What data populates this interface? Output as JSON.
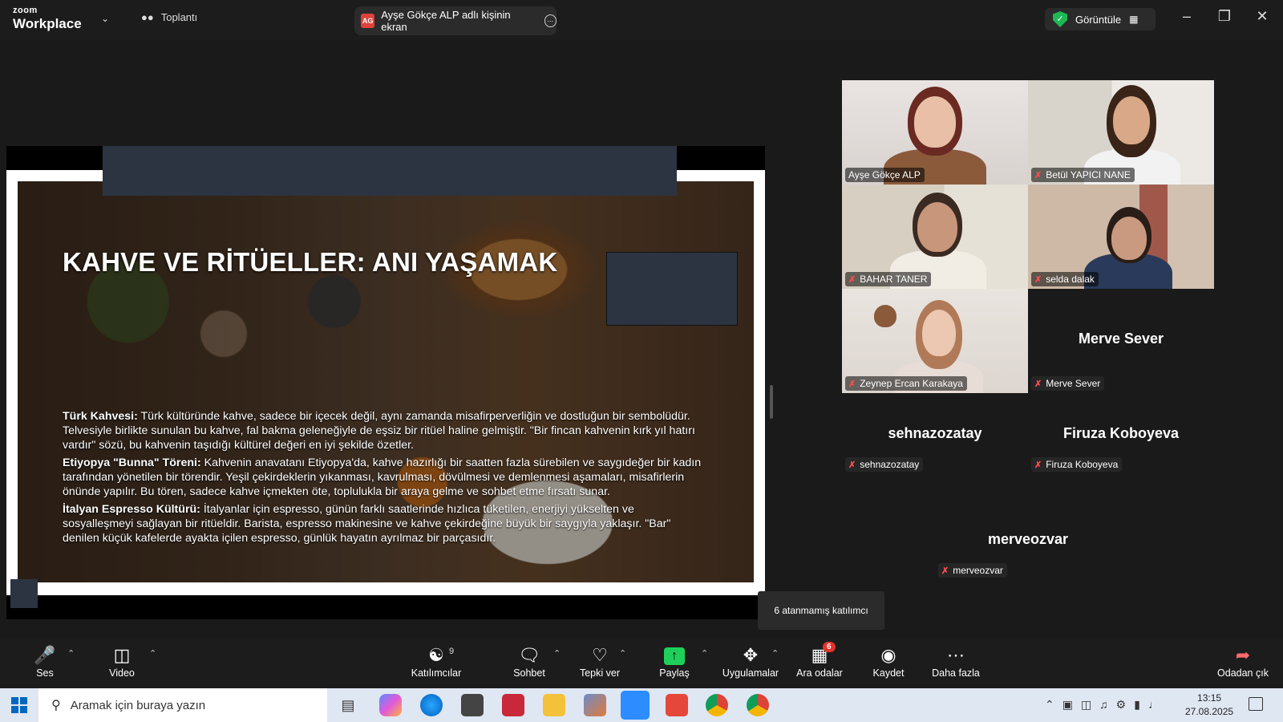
{
  "titlebar": {
    "brand_small": "zoom",
    "brand_large": "Workplace",
    "meeting_label": "Toplantı",
    "share_tab_initials": "AG",
    "share_tab_label": "Ayşe Gökçe ALP adlı kişinin ekran",
    "view_label": "Görüntüle"
  },
  "slide": {
    "title": "KAHVE VE RİTÜELLER: ANI YAŞAMAK",
    "paragraphs": [
      {
        "heading": "Türk Kahvesi:",
        "text": " Türk kültüründe kahve, sadece bir içecek değil, aynı zamanda misafirperverliğin ve dostluğun bir sembolüdür. Telvesiyle birlikte sunulan bu kahve, fal bakma geleneğiyle de eşsiz bir ritüel haline gelmiştir. \"Bir fincan kahvenin kırk yıl hatırı vardır\" sözü, bu kahvenin taşıdığı kültürel değeri en iyi şekilde özetler."
      },
      {
        "heading": "Etiyopya \"Bunna\" Töreni:",
        "text": " Kahvenin anavatanı Etiyopya'da, kahve hazırlığı bir saatten fazla sürebilen ve saygıdeğer bir kadın tarafından yönetilen bir törendir. Yeşil çekirdeklerin yıkanması, kavrulması, dövülmesi ve demlenmesi aşamaları, misafirlerin önünde yapılır. Bu tören, sadece kahve içmekten öte, toplulukla bir araya gelme ve sohbet etme fırsatı sunar."
      },
      {
        "heading": "İtalyan Espresso Kültürü:",
        "text": " İtalyanlar için espresso, günün farklı saatlerinde hızlıca tüketilen, enerjiyi yükselten ve sosyalleşmeyi sağlayan bir ritüeldir. Barista, espresso makinesine ve kahve çekirdeğine büyük bir saygıyla yaklaşır. \"Bar\" denilen küçük kafelerde ayakta içilen espresso, günlük hayatın ayrılmaz bir parçasıdır."
      }
    ]
  },
  "participants": {
    "video": [
      {
        "name": "Ayşe Gökçe ALP",
        "muted": false,
        "active": true
      },
      {
        "name": "Betül YAPICI NANE",
        "muted": true,
        "active": false
      },
      {
        "name": "BAHAR TANER",
        "muted": true,
        "active": false
      },
      {
        "name": "selda dalak",
        "muted": true,
        "active": false
      },
      {
        "name": "Zeynep Ercan Karakaya",
        "muted": true,
        "active": false
      }
    ],
    "no_video": [
      {
        "display": "Merve Sever",
        "tag": "Merve Sever"
      },
      {
        "display": "sehnazozatay",
        "tag": "sehnazozatay"
      },
      {
        "display": "Firuza Koboyeva",
        "tag": "Firuza Koboyeva"
      },
      {
        "display": "merveozvar",
        "tag": "merveozvar"
      }
    ]
  },
  "tooltip": "6 atanmamış katılımcı",
  "toolbar": {
    "audio": "Ses",
    "video": "Video",
    "participants": "Katılımcılar",
    "participants_count": "9",
    "chat": "Sohbet",
    "react": "Tepki ver",
    "share": "Paylaş",
    "apps": "Uygulamalar",
    "breakout": "Ara odalar",
    "breakout_badge": "6",
    "record": "Kaydet",
    "more": "Daha fazla",
    "leave": "Odadan çık"
  },
  "taskbar": {
    "search_placeholder": "Aramak için buraya yazın",
    "time": "13:15",
    "date": "27.08.2025"
  },
  "colors": {
    "active_speaker": "#2dde5e",
    "share_green": "#1ed05a",
    "muted_red": "#ff4d4d",
    "badge_red": "#e5332a"
  }
}
